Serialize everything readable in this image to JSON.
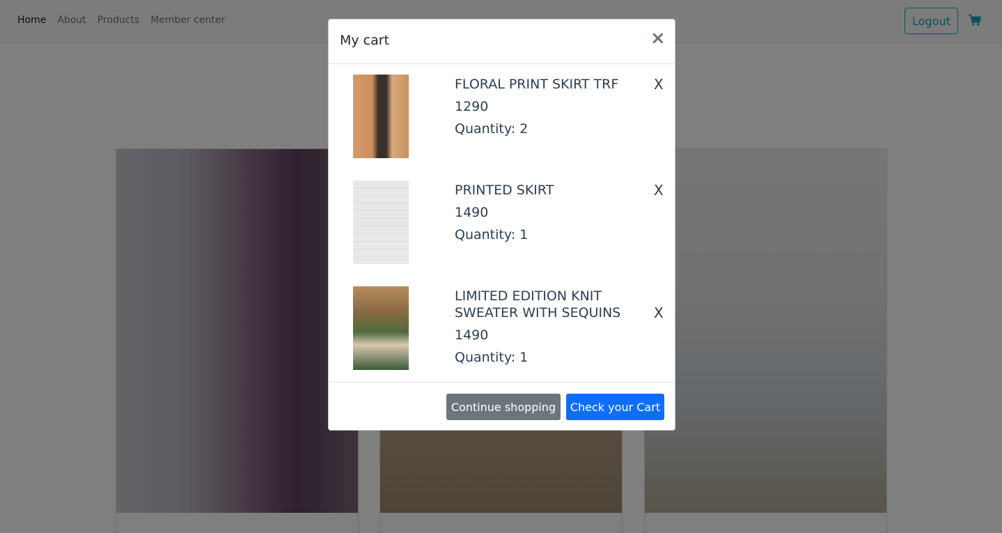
{
  "nav": {
    "links": [
      "Home",
      "About",
      "Products",
      "Member center"
    ],
    "logout_label": "Logout",
    "cart_icon": "shopping-cart-icon"
  },
  "modal": {
    "title": "My cart",
    "close_label": "×",
    "items": [
      {
        "name": "FLORAL PRINT SKIRT TRF",
        "price": "1290",
        "quantity": "Quantity: 2",
        "remove_label": "X"
      },
      {
        "name": "PRINTED SKIRT",
        "price": "1490",
        "quantity": "Quantity: 1",
        "remove_label": "X"
      },
      {
        "name": "LIMITED EDITION KNIT SWEATER WITH SEQUINS",
        "price": "1490",
        "quantity": "Quantity: 1",
        "remove_label": "X"
      }
    ],
    "continue_label": "Continue shopping",
    "check_label": "Check your Cart"
  },
  "colors": {
    "accent_teal": "#17a2b8",
    "primary_blue": "#0d6efd",
    "secondary_gray": "#6c757d",
    "text_dark": "#2c3e50"
  }
}
